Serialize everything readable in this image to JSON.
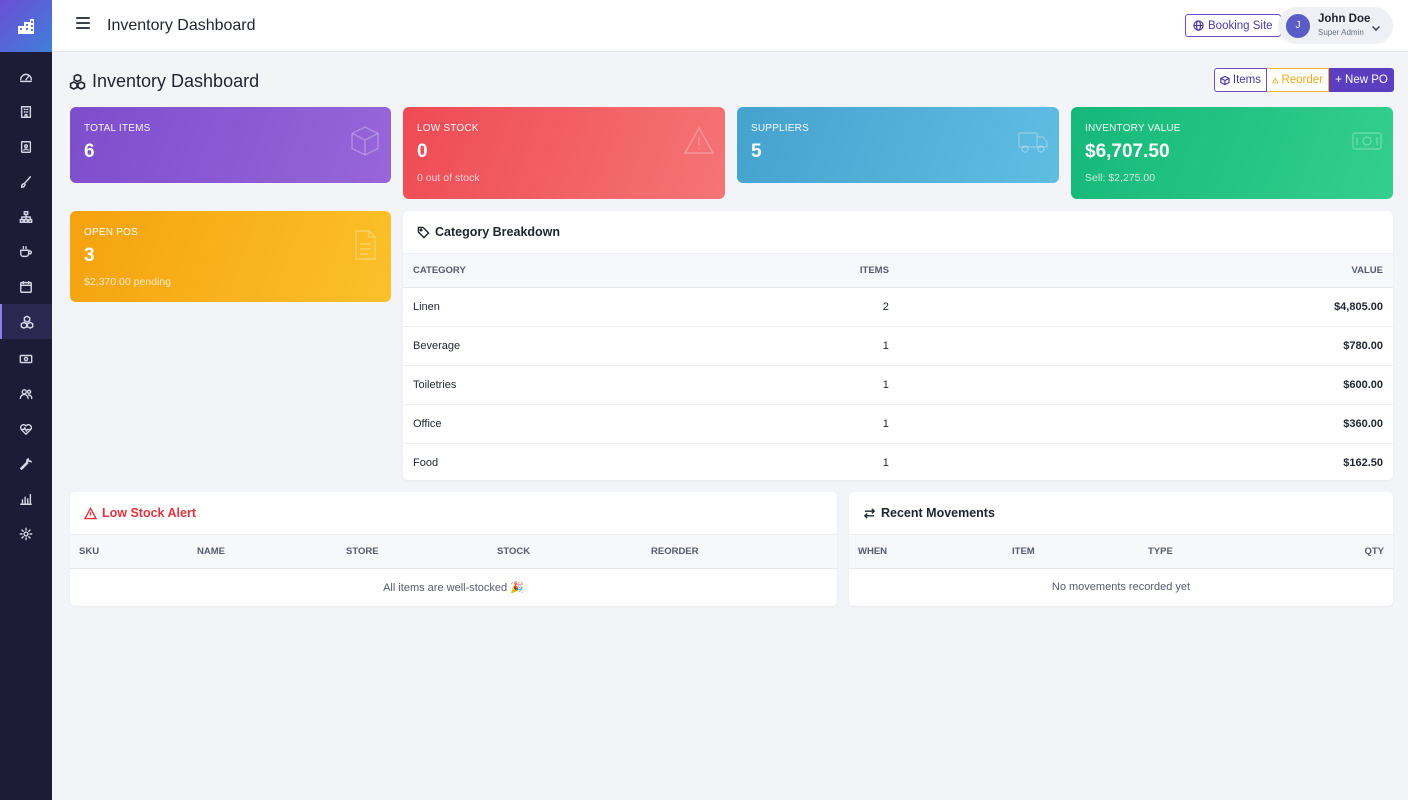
{
  "sidebar": {
    "items": [
      {
        "name": "dashboard-icon",
        "active": false
      },
      {
        "name": "building-icon",
        "active": false
      },
      {
        "name": "clipboard-icon",
        "active": false
      },
      {
        "name": "brush-icon",
        "active": false
      },
      {
        "name": "sitemap-icon",
        "active": false
      },
      {
        "name": "cup-icon",
        "active": false
      },
      {
        "name": "calendar-icon",
        "active": false
      },
      {
        "name": "boxes-icon",
        "active": true
      },
      {
        "name": "cash-icon",
        "active": false
      },
      {
        "name": "users-icon",
        "active": false
      },
      {
        "name": "heart-pulse-icon",
        "active": false
      },
      {
        "name": "wrench-icon",
        "active": false
      },
      {
        "name": "bar-chart-icon",
        "active": false
      },
      {
        "name": "gear-icon",
        "active": false
      }
    ]
  },
  "topbar": {
    "title": "Inventory Dashboard",
    "booking_label": "Booking Site",
    "user": {
      "initial": "J",
      "name": "John Doe",
      "role": "Super Admin"
    }
  },
  "page": {
    "title": "Inventory Dashboard",
    "actions": {
      "items": "Items",
      "reorder": "Reorder",
      "new_po": "+ New PO"
    }
  },
  "stats": {
    "total_items": {
      "label": "TOTAL ITEMS",
      "value": "6"
    },
    "low_stock": {
      "label": "LOW STOCK",
      "value": "0",
      "sub": "0 out of stock"
    },
    "suppliers": {
      "label": "SUPPLIERS",
      "value": "5"
    },
    "inventory_value": {
      "label": "INVENTORY VALUE",
      "value": "$6,707.50",
      "sub": "Sell: $2,275.00"
    },
    "open_pos": {
      "label": "OPEN POS",
      "value": "3",
      "sub": "$2,370.00 pending"
    }
  },
  "category": {
    "title": "Category Breakdown",
    "headers": {
      "category": "CATEGORY",
      "items": "ITEMS",
      "value": "VALUE"
    },
    "rows": [
      {
        "category": "Linen",
        "items": "2",
        "value": "$4,805.00"
      },
      {
        "category": "Beverage",
        "items": "1",
        "value": "$780.00"
      },
      {
        "category": "Toiletries",
        "items": "1",
        "value": "$600.00"
      },
      {
        "category": "Office",
        "items": "1",
        "value": "$360.00"
      },
      {
        "category": "Food",
        "items": "1",
        "value": "$162.50"
      }
    ]
  },
  "low_stock": {
    "title": "Low Stock Alert",
    "headers": {
      "sku": "SKU",
      "name": "NAME",
      "store": "STORE",
      "stock": "STOCK",
      "reorder": "REORDER"
    },
    "empty": "All items are well-stocked 🎉"
  },
  "movements": {
    "title": "Recent Movements",
    "headers": {
      "when": "WHEN",
      "item": "ITEM",
      "type": "TYPE",
      "qty": "QTY"
    },
    "empty": "No movements recorded yet"
  },
  "colors": {
    "sidebar": "#1d1b36",
    "accent": "#5b3fc0",
    "danger": "#e0353f",
    "warning": "#f0a81e"
  }
}
